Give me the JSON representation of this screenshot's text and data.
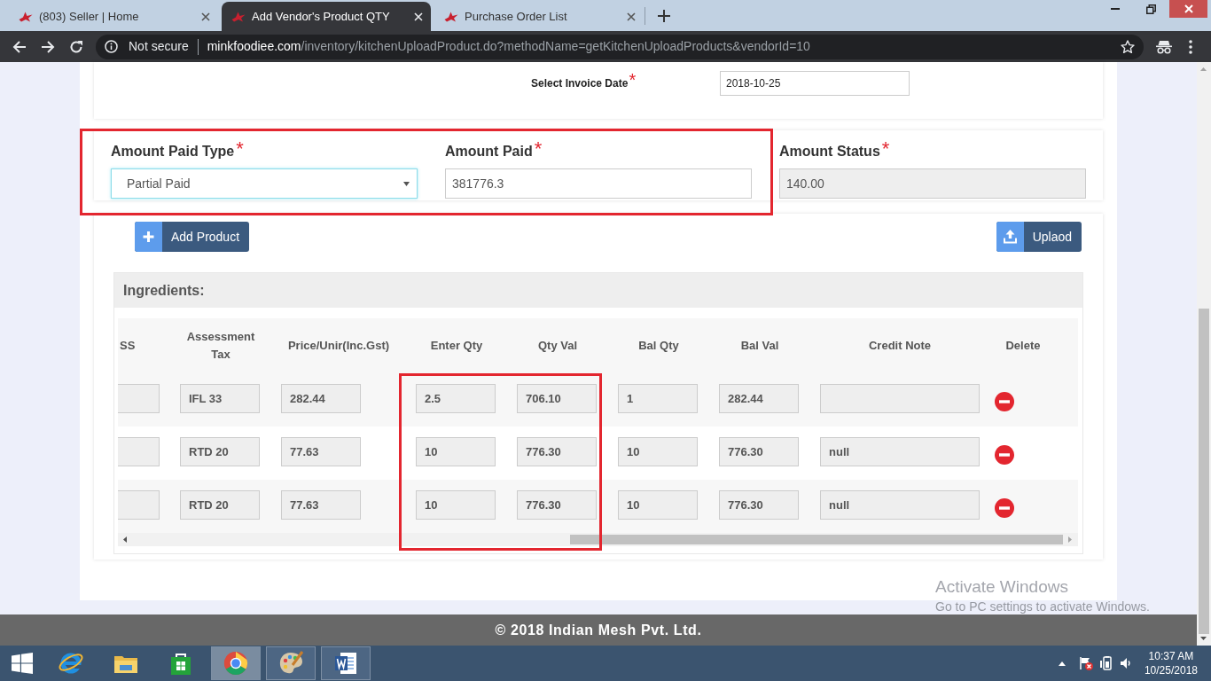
{
  "browser": {
    "tabs": [
      {
        "title": "(803) Seller | Home",
        "selected": false
      },
      {
        "title": "Add Vendor's Product QTY",
        "selected": true
      },
      {
        "title": "Purchase Order List",
        "selected": false
      }
    ],
    "address_bar": {
      "security": "Not secure",
      "host": "minkfoodiee.com",
      "path": "/inventory/kitchenUploadProduct.do?methodName=getKitchenUploadProducts&vendorId=10"
    }
  },
  "invoice": {
    "label": "Select Invoice Date",
    "required_mark": "*",
    "value": "2018-10-25"
  },
  "payment_fields": [
    {
      "kind": "select",
      "label": "Amount Paid Type",
      "required_mark": "*",
      "value": "Partial Paid",
      "focused": true,
      "disabled": false,
      "highlighted": true
    },
    {
      "kind": "input",
      "label": "Amount Paid",
      "required_mark": "*",
      "value": "381776.3",
      "focused": false,
      "disabled": false,
      "highlighted": true
    },
    {
      "kind": "input",
      "label": "Amount Status",
      "required_mark": "*",
      "value": "140.00",
      "focused": false,
      "disabled": true,
      "highlighted": false
    }
  ],
  "actions": [
    {
      "kind": "add",
      "label": "Add Product"
    },
    {
      "kind": "upload",
      "label": "Uplaod"
    }
  ],
  "ingredients": {
    "title": "Ingredients:",
    "columns": [
      {
        "kind": "field",
        "label": "SS",
        "highlighted": false
      },
      {
        "kind": "field",
        "label": "Assessment Tax",
        "highlighted": false
      },
      {
        "kind": "field",
        "label": "Price/Unir(Inc.Gst)",
        "highlighted": false
      },
      {
        "kind": "field",
        "label": "Enter Qty",
        "highlighted": true
      },
      {
        "kind": "field",
        "label": "Qty Val",
        "highlighted": true
      },
      {
        "kind": "field",
        "label": "Bal Qty",
        "highlighted": false
      },
      {
        "kind": "field",
        "label": "Bal Val",
        "highlighted": false
      },
      {
        "kind": "field",
        "label": "Credit Note",
        "highlighted": false
      },
      {
        "kind": "delete",
        "label": "Delete",
        "highlighted": false
      }
    ],
    "rows": [
      {
        "cells": [
          null,
          "IFL 33",
          "282.44",
          "2.5",
          "706.10",
          "1",
          "282.44",
          null
        ]
      },
      {
        "cells": [
          null,
          "RTD 20",
          "77.63",
          "10",
          "776.30",
          "10",
          "776.30",
          "null"
        ]
      },
      {
        "cells": [
          null,
          "RTD 20",
          "77.63",
          "10",
          "776.30",
          "10",
          "776.30",
          "null"
        ]
      }
    ]
  },
  "footer": "© 2018 Indian Mesh Pvt. Ltd.",
  "os_notice": {
    "title": "Activate Windows",
    "text": "Go to PC settings to activate Windows."
  },
  "taskbar": {
    "apps": [
      {
        "kind": "ie",
        "running": false,
        "selected": false
      },
      {
        "kind": "explorer",
        "running": false,
        "selected": false
      },
      {
        "kind": "store",
        "running": false,
        "selected": false
      },
      {
        "kind": "chrome",
        "running": true,
        "selected": true
      },
      {
        "kind": "paint",
        "running": true,
        "selected": false
      },
      {
        "kind": "word",
        "running": true,
        "selected": false
      }
    ],
    "clock": {
      "time": "10:37 AM",
      "date": "10/25/2018"
    }
  }
}
